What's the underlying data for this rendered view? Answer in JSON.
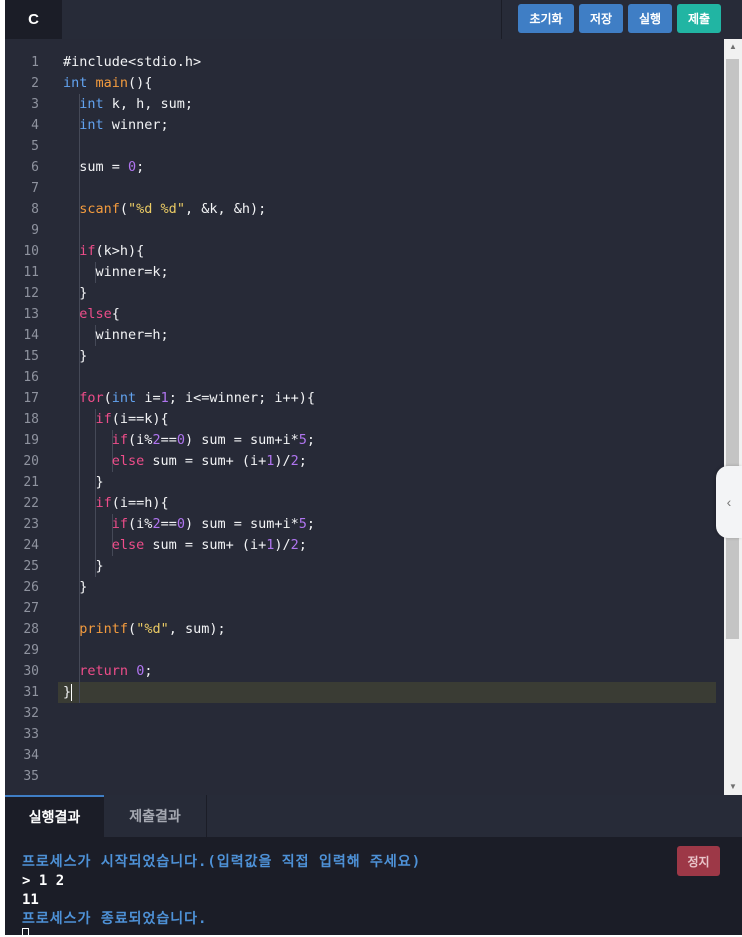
{
  "header": {
    "language_tab": "C",
    "buttons": {
      "reset": "초기화",
      "save": "저장",
      "run": "실행",
      "submit": "제출"
    }
  },
  "editor": {
    "line_numbers": [
      "1",
      "2",
      "3",
      "4",
      "5",
      "6",
      "7",
      "8",
      "9",
      "10",
      "11",
      "12",
      "13",
      "14",
      "15",
      "16",
      "17",
      "18",
      "19",
      "20",
      "21",
      "22",
      "23",
      "24",
      "25",
      "26",
      "27",
      "28",
      "29",
      "30",
      "31",
      "32",
      "33",
      "34",
      "35"
    ],
    "code": [
      "#include<stdio.h>",
      "int main(){",
      "  int k, h, sum;",
      "  int winner;",
      "",
      "  sum = 0;",
      "",
      "  scanf(\"%d %d\", &k, &h);",
      "",
      "  if(k>h){",
      "    winner=k;",
      "  }",
      "  else{",
      "    winner=h;",
      "  }",
      "",
      "  for(int i=1; i<=winner; i++){",
      "    if(i==k){",
      "      if(i%2==0) sum = sum+i*5;",
      "      else sum = sum+ (i+1)/2;",
      "    }",
      "    if(i==h){",
      "      if(i%2==0) sum = sum+i*5;",
      "      else sum = sum+ (i+1)/2;",
      "    }",
      "  }",
      "",
      "  printf(\"%d\", sum);",
      "",
      "  return 0;",
      "}"
    ]
  },
  "bottom_panel": {
    "tabs": [
      "실행결과",
      "제출결과"
    ],
    "stop_label": "정지",
    "console": {
      "start_msg": "프로세스가 시작되었습니다.(입력값을 직접 입력해 주세요)",
      "input_line": "> 1 2",
      "output_line": "11",
      "end_msg": "프로세스가 종료되었습니다."
    }
  },
  "icons": {
    "scroll_up": "triangle-up",
    "scroll_down": "triangle-down",
    "side_panel_toggle": "chevron-left"
  }
}
